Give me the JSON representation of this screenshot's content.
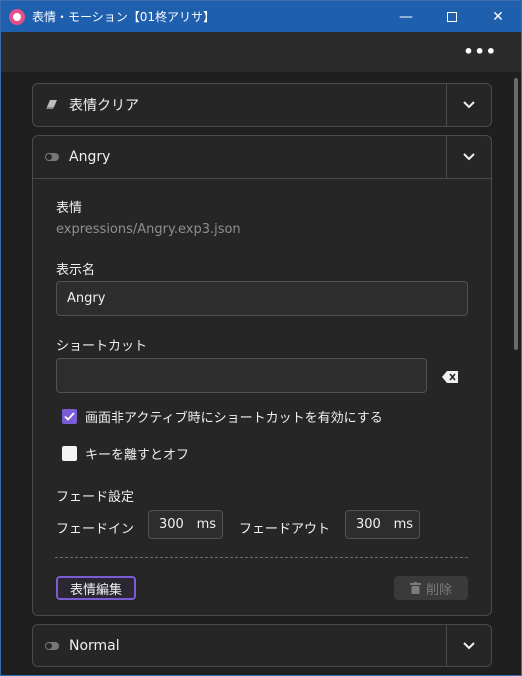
{
  "window": {
    "title": "表情・モーション【01柊アリサ】",
    "controls": {
      "minimize": "—",
      "close": "✕"
    }
  },
  "toolbar": {
    "more_label": "•••"
  },
  "cards": [
    {
      "label": "表情クリア",
      "icon": "eraser-icon"
    },
    {
      "label": "Angry",
      "icon": "toggle-icon",
      "expression_title": "表情",
      "expression_path": "expressions/Angry.exp3.json",
      "display_name_title": "表示名",
      "display_name_value": "Angry",
      "shortcut_title": "ショートカット",
      "shortcut_value": "",
      "checkbox_inactive_label": "画面非アクティブ時にショートカットを有効にする",
      "checkbox_inactive_checked": true,
      "checkbox_release_label": "キーを離すとオフ",
      "checkbox_release_checked": false,
      "fade_title": "フェード設定",
      "fade_in_label": "フェードイン",
      "fade_in_value": "300",
      "fade_out_label": "フェードアウト",
      "fade_out_value": "300",
      "unit": "ms",
      "edit_button": "表情編集",
      "delete_button": "削除"
    },
    {
      "label": "Normal",
      "icon": "toggle-icon"
    }
  ],
  "colors": {
    "titlebar": "#1e5fae",
    "accent": "#7b5cd6",
    "background": "#1f1f1f"
  }
}
